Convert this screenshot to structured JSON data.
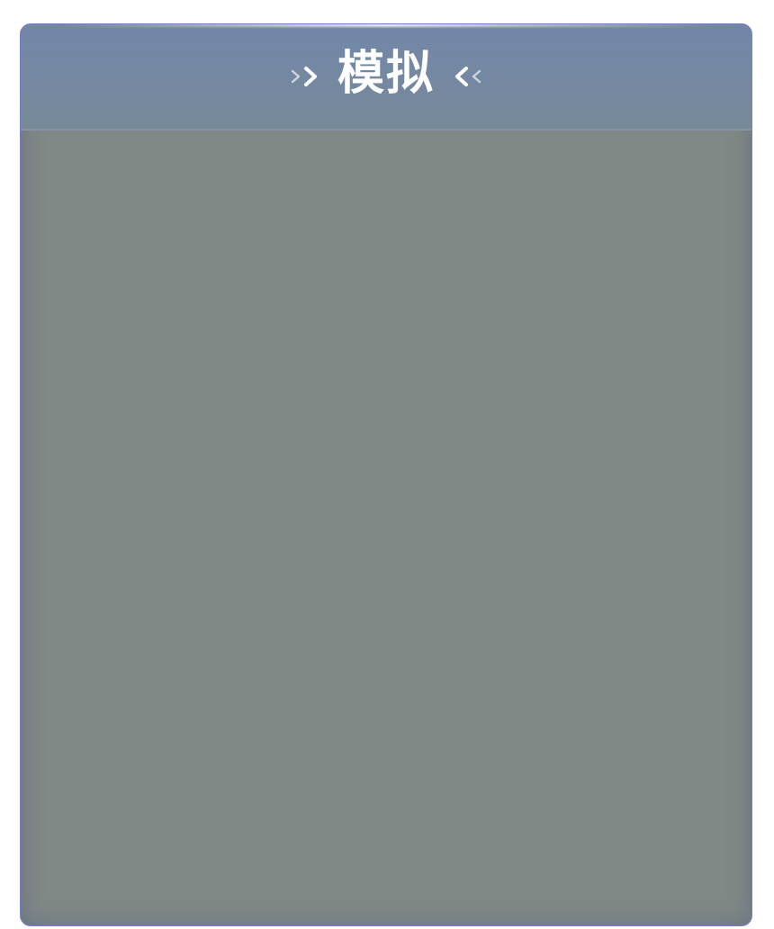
{
  "panel": {
    "title": "模拟",
    "left_icon": "chevron-double-right-icon",
    "right_icon": "chevron-double-left-icon"
  },
  "colors": {
    "header_background": "#7286a9",
    "panel_background": "#808985",
    "border": "#7b7fc2",
    "title_text": "#ffffff"
  }
}
